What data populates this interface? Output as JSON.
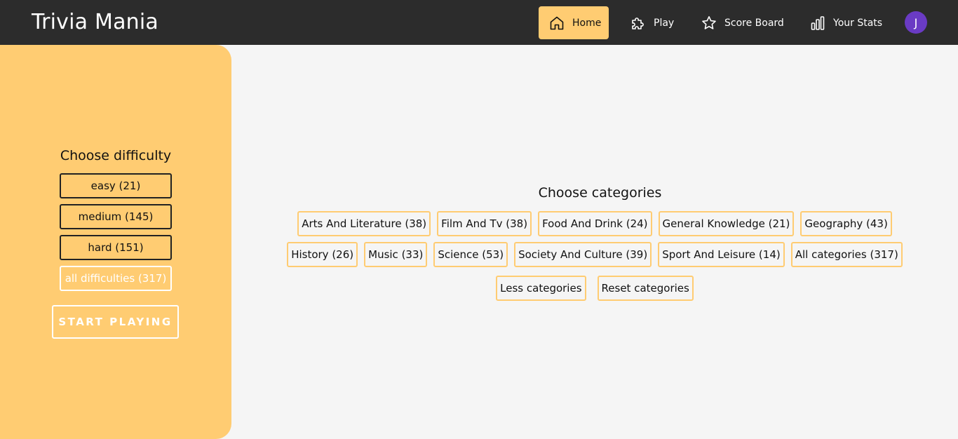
{
  "app": {
    "title": "Trivia Mania"
  },
  "nav": {
    "items": [
      {
        "label": "Home",
        "icon": "home-icon",
        "active": true
      },
      {
        "label": "Play",
        "icon": "puzzle-icon",
        "active": false
      },
      {
        "label": "Score Board",
        "icon": "star-icon",
        "active": false
      },
      {
        "label": "Your Stats",
        "icon": "bar-chart-icon",
        "active": false
      }
    ],
    "avatar_initial": "J"
  },
  "difficulty": {
    "title": "Choose difficulty",
    "options": [
      {
        "label": "easy (21)"
      },
      {
        "label": "medium (145)"
      },
      {
        "label": "hard (151)"
      },
      {
        "label": "all difficulties (317)",
        "selected": true
      }
    ],
    "start_label": "START PLAYING"
  },
  "categories": {
    "title": "Choose categories",
    "row1": [
      "Arts And Literature (38)",
      "Film And Tv (38)",
      "Food And Drink (24)",
      "General Knowledge (21)",
      "Geography (43)"
    ],
    "row2": [
      "History (26)",
      "Music (33)",
      "Science (53)",
      "Society And Culture (39)",
      "Sport And Leisure (14)",
      "All categories (317)"
    ],
    "less_label": "Less categories",
    "reset_label": "Reset categories"
  },
  "colors": {
    "topbar": "#2c2c2c",
    "accent": "#ffcc72",
    "avatar": "#6a3bc4",
    "background": "#f5f5f5"
  }
}
